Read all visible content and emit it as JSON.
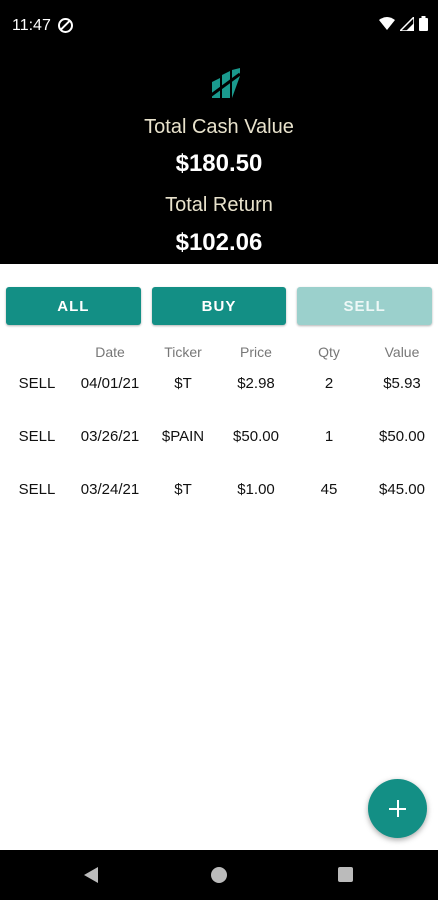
{
  "status_bar": {
    "time": "11:47"
  },
  "header": {
    "cash_label": "Total Cash Value",
    "cash_value": "$180.50",
    "return_label": "Total Return",
    "return_value": "$102.06"
  },
  "filters": [
    {
      "label": "ALL",
      "enabled": true
    },
    {
      "label": "BUY",
      "enabled": true
    },
    {
      "label": "SELL",
      "enabled": false
    }
  ],
  "table": {
    "columns": [
      "",
      "Date",
      "Ticker",
      "Price",
      "Qty",
      "Value"
    ],
    "rows": [
      {
        "type": "SELL",
        "date": "04/01/21",
        "ticker": "$T",
        "price": "$2.98",
        "qty": "2",
        "value": "$5.93"
      },
      {
        "type": "SELL",
        "date": "03/26/21",
        "ticker": "$PAIN",
        "price": "$50.00",
        "qty": "1",
        "value": "$50.00"
      },
      {
        "type": "SELL",
        "date": "03/24/21",
        "ticker": "$T",
        "price": "$1.00",
        "qty": "45",
        "value": "$45.00"
      }
    ]
  },
  "fab_icon": "plus-icon",
  "colors": {
    "accent": "#138f85",
    "accent_disabled": "#9bd0cc",
    "header_bg": "#000000",
    "header_label": "#e8e2cc"
  }
}
